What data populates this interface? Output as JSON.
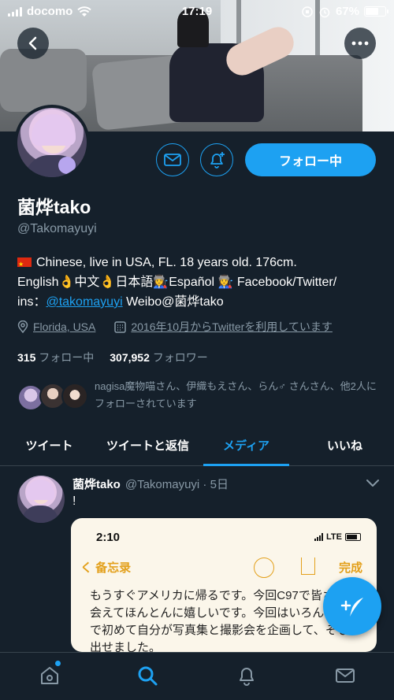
{
  "status_bar": {
    "carrier": "docomo",
    "time": "17:19",
    "battery_percent": "67%",
    "battery_level": 0.67
  },
  "header": {
    "back_icon": "chevron-left-icon",
    "more_icon": "more-horizontal-icon"
  },
  "profile": {
    "display_name": "菌烨tako",
    "handle": "@Takomayuyi",
    "follow_button": "フォロー中",
    "bio_line1": "Chinese, live in USA, FL. 18 years old. 176cm.",
    "bio_line2": "English👌中文👌日本語👩‍🏭Español 👩‍🏭 Facebook/Twitter/",
    "bio_line3_prefix": "ins：",
    "bio_link": "@takomayuyi",
    "bio_line3_suffix": " Weibo@菌烨tako",
    "location": "Florida, USA",
    "joined": "2016年10月からTwitterを利用しています",
    "following_count": "315",
    "following_label": "フォロー中",
    "followers_count": "307,952",
    "followers_label": "フォロワー",
    "followed_by": "nagisa魔物喵さん、伊織もえさん、らん♂ さんさん、他2人にフォローされています"
  },
  "tabs": [
    {
      "label": "ツイート",
      "active": false
    },
    {
      "label": "ツイートと返信",
      "active": false
    },
    {
      "label": "メディア",
      "active": true
    },
    {
      "label": "いいね",
      "active": false
    }
  ],
  "tweet": {
    "name": "菌烨tako",
    "handle_time": "@Takomayuyi · 5日",
    "text": "!",
    "media": {
      "time": "2:10",
      "network": "LTE",
      "back_label": "く 备忘录",
      "done_label": "完成",
      "note": "もうすぐアメリカに帰るです。今回C97で皆さんと会えてほんとんに嬉しいです。今回はいろんな意味で初めて自分が写真集と撮影会を企画して、そして出せました。"
    }
  },
  "colors": {
    "background": "#15202b",
    "accent": "#1da1f2",
    "muted": "#8899a6",
    "divider": "#38444d"
  },
  "nav": {
    "items": [
      "home-icon",
      "search-icon",
      "notifications-icon",
      "messages-icon"
    ],
    "active": "search-icon"
  }
}
